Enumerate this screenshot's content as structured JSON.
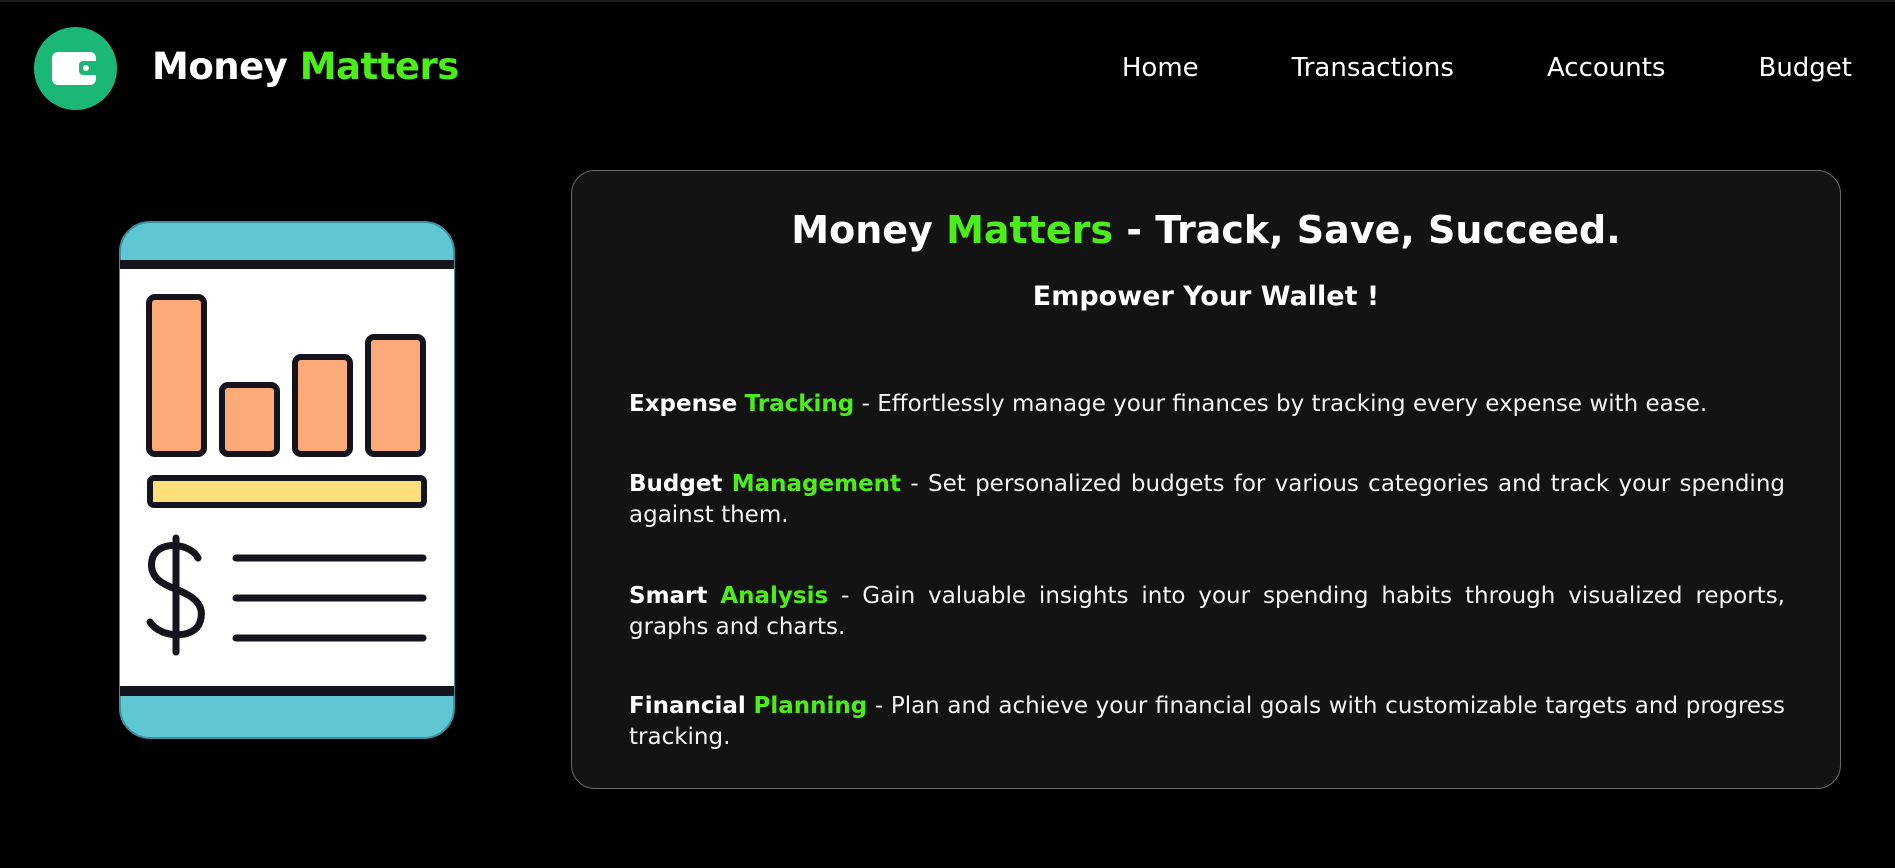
{
  "brand": {
    "name_part1": "Money",
    "name_part2": "Matters",
    "logo_icon": "wallet-icon"
  },
  "nav": {
    "items": [
      {
        "label": "Home"
      },
      {
        "label": "Transactions"
      },
      {
        "label": "Accounts"
      },
      {
        "label": "Budget"
      }
    ]
  },
  "hero": {
    "illustration_icon": "mobile-finance-report-icon",
    "title_part1": "Money",
    "title_part2": "Matters",
    "title_part3": "- Track, Save, Succeed.",
    "subtitle": "Empower Your Wallet !",
    "features": [
      {
        "name_part1": "Expense",
        "name_part2": "Tracking",
        "description": "- Effortlessly manage your finances by tracking every expense with ease."
      },
      {
        "name_part1": "Budget",
        "name_part2": "Management",
        "description": "- Set personalized budgets for various categories and track your spending against them."
      },
      {
        "name_part1": "Smart",
        "name_part2": "Analysis",
        "description": "- Gain valuable insights into your spending habits through visualized reports, graphs and charts."
      },
      {
        "name_part1": "Financial",
        "name_part2": "Planning",
        "description": "- Plan and achieve your financial goals with customizable targets and progress tracking."
      }
    ]
  },
  "colors": {
    "background": "#000000",
    "card_background": "#131313",
    "accent_green": "#4cee1a",
    "logo_green": "#1bb777",
    "phone_teal": "#5ec7d3",
    "bar_orange": "#fcaa77",
    "bar_yellow": "#fde07a"
  }
}
